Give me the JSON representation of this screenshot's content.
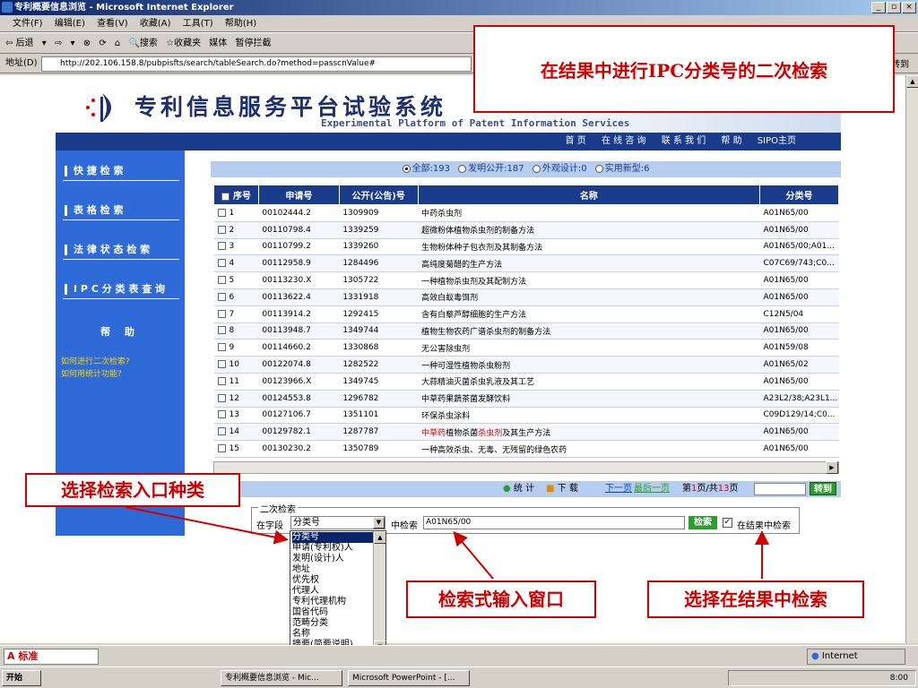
{
  "window": {
    "title": "专利概要信息浏览 - Microsoft Internet Explorer",
    "min": "_",
    "max": "▫",
    "close": "×"
  },
  "menu": [
    "文件(F)",
    "编辑(E)",
    "查看(V)",
    "收藏(A)",
    "工具(T)",
    "帮助(H)"
  ],
  "toolbar": [
    "⇦ 后退",
    "▾",
    "⇨",
    "▾",
    "⊗",
    "⟳",
    "⌂",
    "🔍搜索",
    "☆收藏夹",
    "媒体",
    "暂停拦截"
  ],
  "address": {
    "label": "地址(D)",
    "url": "http://202.106.158.8/pubpisfts/search/tableSearch.do?method=passcnValue#",
    "go": "转到"
  },
  "site": {
    "title": "专利信息服务平台试验系统",
    "subtitle": "Experimental Platform of Patent Information Services",
    "nav": [
      "首 页",
      "在 线 咨 询",
      "联 系 我 们",
      "帮 助",
      "SIPO主页"
    ]
  },
  "sidebar": {
    "items": [
      "快 捷 检 索",
      "表 格 检 索",
      "法 律 状 态 检 索",
      "I P C 分 类 表 查 询"
    ],
    "help_title": "帮 助",
    "help_links": [
      "如何进行二次检索?",
      "如何用统计功能?"
    ]
  },
  "filters": [
    "全部:193",
    "发明公开:187",
    "外观设计:0",
    "实用新型:6"
  ],
  "table": {
    "headers": [
      "序号",
      "申请号",
      "公开(公告)号",
      "名称",
      "分类号"
    ],
    "rows": [
      [
        "1",
        "00102444.2",
        "1309909",
        "中药杀虫剂",
        "A01N65/00"
      ],
      [
        "2",
        "00110798.4",
        "1339259",
        "超微粉体植物杀虫剂的制备方法",
        "A01N65/00"
      ],
      [
        "3",
        "00110799.2",
        "1339260",
        "生物粉体种子包衣剂及其制备方法",
        "A01N65/00;A01..."
      ],
      [
        "4",
        "00112958.9",
        "1284496",
        "高纯度菊醋的生产方法",
        "C07C69/743;C0..."
      ],
      [
        "5",
        "00113230.X",
        "1305722",
        "一种植物杀虫剂及其配制方法",
        "A01N65/00"
      ],
      [
        "6",
        "00113622.4",
        "1331918",
        "高效白蚁毒饵剂",
        "A01N65/00"
      ],
      [
        "7",
        "00113914.2",
        "1292415",
        "含有白藜芦醇细胞的生产方法",
        "C12N5/04"
      ],
      [
        "8",
        "00113948.7",
        "1349744",
        "植物生物农药广谱杀虫剂的制备方法",
        "A01N65/00"
      ],
      [
        "9",
        "00114660.2",
        "1330868",
        "无公害除虫剂",
        "A01N59/08"
      ],
      [
        "10",
        "00122074.8",
        "1282522",
        "一种可湿性植物杀虫粉剂",
        "A01N65/02"
      ],
      [
        "11",
        "00123966.X",
        "1349745",
        "大蒜精油灭菌杀虫乳液及其工艺",
        "A01N65/00"
      ],
      [
        "12",
        "00124553.8",
        "1296782",
        "中草药果蔬茶菌发酵饮料",
        "A23L2/38;A23L1..."
      ],
      [
        "13",
        "00127106.7",
        "1351101",
        "环保杀虫涂料",
        "C09D129/14;C0..."
      ],
      [
        "14",
        "00129782.1",
        "1287787",
        "中草药植物杀菌杀虫剂及其生产方法",
        "A01N65/00"
      ],
      [
        "15",
        "00130230.2",
        "1350789",
        "一种高效杀虫、无毒、无残留的绿色农药",
        "A01N65/00"
      ]
    ],
    "row14_parts": [
      "中草药",
      "植物杀菌",
      "杀虫剂",
      "及其生产方法"
    ]
  },
  "pager": {
    "stats": "统 计",
    "download": "下 载",
    "next": "下一页",
    "last": "最后一页",
    "page_prefix": "第",
    "page_cur": "1",
    "page_mid": "页/共",
    "page_total": "13",
    "page_suffix": "页",
    "go": "转到"
  },
  "secondary": {
    "legend": "二次检索",
    "field_label": "在字段",
    "field_value": "分类号",
    "in_label": "中检索",
    "query": "A01N65/00",
    "search_btn": "检索",
    "within_label": "在结果中检索",
    "options": [
      "分类号",
      "申请(专利权)人",
      "发明(设计)人",
      "地址",
      "优先权",
      "代理人",
      "专利代理机构",
      "国省代码",
      "范畴分类",
      "名称",
      "摘要(简要说明)"
    ]
  },
  "annotations": {
    "top": "在结果中进行IPC分类号的二次检索",
    "left": "选择检索入口种类",
    "mid": "检索式输入窗口",
    "right": "选择在结果中检索"
  },
  "statusbar": {
    "ime": "A 标准",
    "zone": "Internet"
  },
  "taskbar": {
    "start": "开始",
    "tasks": [
      "专利概要信息浏览 - Mic...",
      "Microsoft PowerPoint - [..."
    ],
    "clock": "8:00"
  },
  "colors": {
    "nav_blue": "#1a3a8a",
    "sidebar_blue": "#2e6ad8",
    "annot_red": "#d00000",
    "btn_green": "#2e9b2e"
  }
}
